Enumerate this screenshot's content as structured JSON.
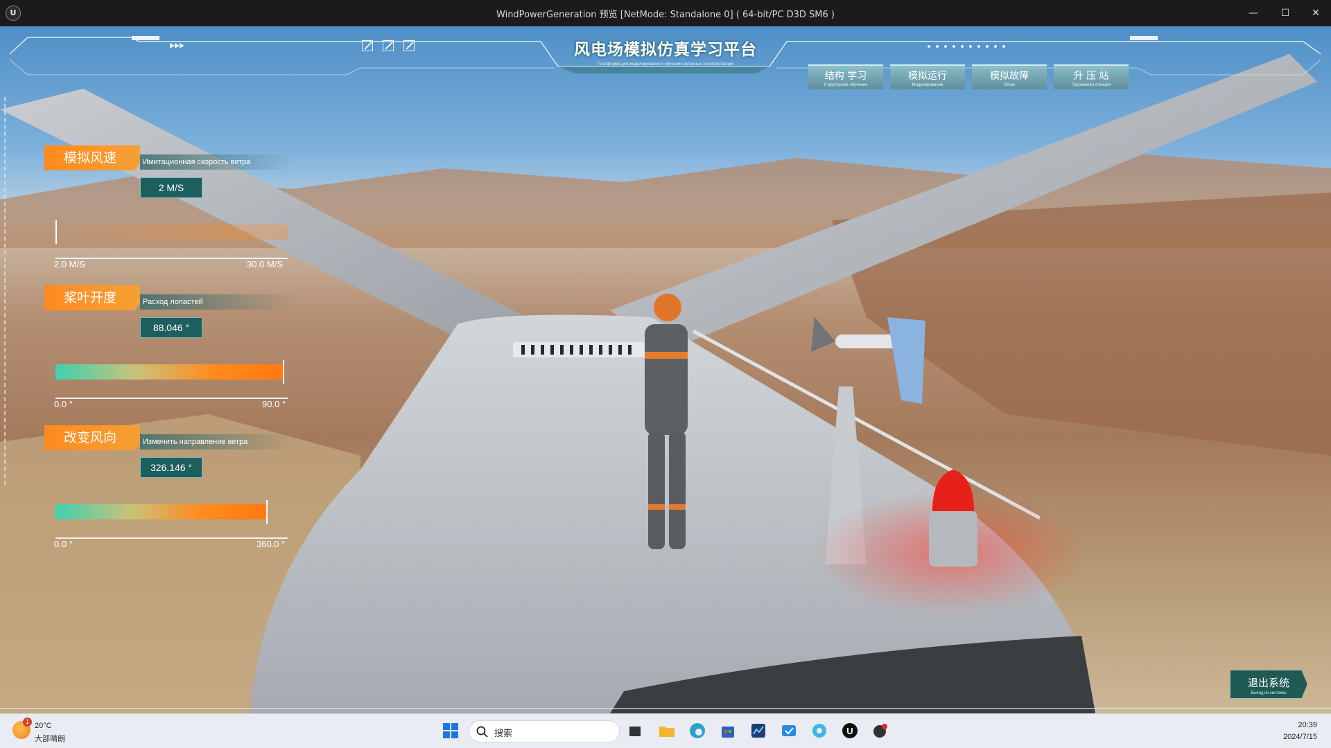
{
  "window": {
    "title": "WindPowerGeneration 预览 [NetMode: Standalone 0]  ( 64-bit/PC D3D SM6 )",
    "app_logo": "U",
    "minimize_glyph": "—",
    "maximize_glyph": "☐",
    "close_glyph": "✕"
  },
  "header": {
    "title": "风电场模拟仿真学习平台",
    "subtitle": "Платформа для моделирования и обучения ветряных электростанций",
    "nav": [
      {
        "label": "结构 学习",
        "sub": "Структурное обучение"
      },
      {
        "label": "模拟运行",
        "sub": "Моделирование"
      },
      {
        "label": "模拟故障",
        "sub": "Отказ"
      },
      {
        "label": "升 压 站",
        "sub": "Подъёмная станция"
      }
    ]
  },
  "panels": {
    "wind_speed": {
      "tag": "模拟风速",
      "subtitle": "Имитационная скорость ветра",
      "value": "2 M/S",
      "min_label": "2.0 M/S",
      "max_label": "30.0 M/S",
      "level": 0.0
    },
    "blade_pitch": {
      "tag": "桨叶开度",
      "subtitle": "Расход лопастей",
      "value": "88.046 °",
      "min_label": "0.0 °",
      "max_label": "90.0 °",
      "level": 0.978
    },
    "wind_direction": {
      "tag": "改变风向",
      "subtitle": "Изменить направление ветра",
      "value": "326.146 °",
      "min_label": "0.0 °",
      "max_label": "360.0 °",
      "level": 0.906
    }
  },
  "exit": {
    "label": "退出系统",
    "sub": "Выход из системы"
  },
  "taskbar": {
    "weather_badge": "1",
    "weather_temp": "20°C",
    "weather_desc": "大部晴朗",
    "search_placeholder": "搜索",
    "time": "20:39",
    "date": "2024/7/15",
    "apps": [
      "windows-start-icon",
      "task-view-icon",
      "file-explorer-icon",
      "edge-browser-icon",
      "microsoft-store-icon",
      "app-chart-icon",
      "app-todo-icon",
      "app-chat-icon",
      "unreal-engine-icon",
      "app-record-icon"
    ]
  },
  "colors": {
    "accent_orange": "#ff8a1e",
    "hud_teal": "#1d5f5e",
    "hud_line": "#e8f2f2"
  }
}
